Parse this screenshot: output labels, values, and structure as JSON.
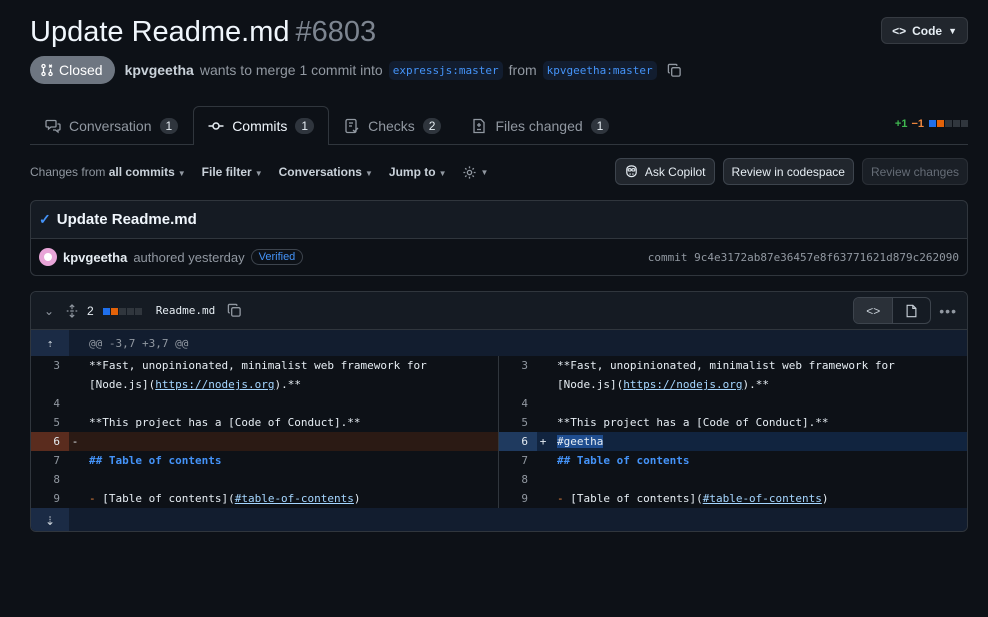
{
  "pr": {
    "title": "Update Readme.md",
    "number": "#6803",
    "status": "Closed",
    "author": "kpvgeetha",
    "merge_text_1": "wants to merge 1 commit into",
    "base_branch": "expressjs:master",
    "merge_text_2": "from",
    "head_branch": "kpvgeetha:master",
    "code_button": "Code"
  },
  "tabs": [
    {
      "label": "Conversation",
      "count": "1",
      "icon": "comment-discussion-icon"
    },
    {
      "label": "Commits",
      "count": "1",
      "icon": "git-commit-icon"
    },
    {
      "label": "Checks",
      "count": "2",
      "icon": "checklist-icon"
    },
    {
      "label": "Files changed",
      "count": "1",
      "icon": "file-diff-icon"
    }
  ],
  "diffstat": {
    "additions": "+1",
    "deletions": "−1"
  },
  "toolbar": {
    "changes_prefix": "Changes from",
    "changes_value": "all commits",
    "file_filter": "File filter",
    "conversations": "Conversations",
    "jump_to": "Jump to",
    "ask_copilot": "Ask Copilot",
    "review_codespace": "Review in codespace",
    "review_changes": "Review changes"
  },
  "commit": {
    "title": "Update Readme.md",
    "author": "kpvgeetha",
    "authored": "authored yesterday",
    "verified": "Verified",
    "sha": "commit 9c4e3172ab87e36457e8f63771621d879c262090"
  },
  "file": {
    "changes": "2",
    "name": "Readme.md",
    "hunk": "@@ -3,7 +3,7 @@"
  },
  "diff": {
    "left": [
      {
        "ln": "3",
        "mark": "",
        "text": "**Fast, unopinionated, minimalist web framework for"
      },
      {
        "ln": "",
        "mark": "",
        "text": "[Node.js](https://nodejs.org).**"
      },
      {
        "ln": "4",
        "mark": "",
        "text": ""
      },
      {
        "ln": "5",
        "mark": "",
        "text": "**This project has a [Code of Conduct].**"
      },
      {
        "ln": "6",
        "mark": "-",
        "text": ""
      },
      {
        "ln": "7",
        "mark": "",
        "text": "## Table of contents"
      },
      {
        "ln": "8",
        "mark": "",
        "text": ""
      },
      {
        "ln": "9",
        "mark": "",
        "text": "- [Table of contents](#table-of-contents)"
      }
    ],
    "right": [
      {
        "ln": "3",
        "mark": "",
        "text": "**Fast, unopinionated, minimalist web framework for"
      },
      {
        "ln": "",
        "mark": "",
        "text": "[Node.js](https://nodejs.org).**"
      },
      {
        "ln": "4",
        "mark": "",
        "text": ""
      },
      {
        "ln": "5",
        "mark": "",
        "text": "**This project has a [Code of Conduct].**"
      },
      {
        "ln": "6",
        "mark": "+",
        "text": "#geetha"
      },
      {
        "ln": "7",
        "mark": "",
        "text": "## Table of contents"
      },
      {
        "ln": "8",
        "mark": "",
        "text": ""
      },
      {
        "ln": "9",
        "mark": "",
        "text": "- [Table of contents](#table-of-contents)"
      }
    ]
  }
}
